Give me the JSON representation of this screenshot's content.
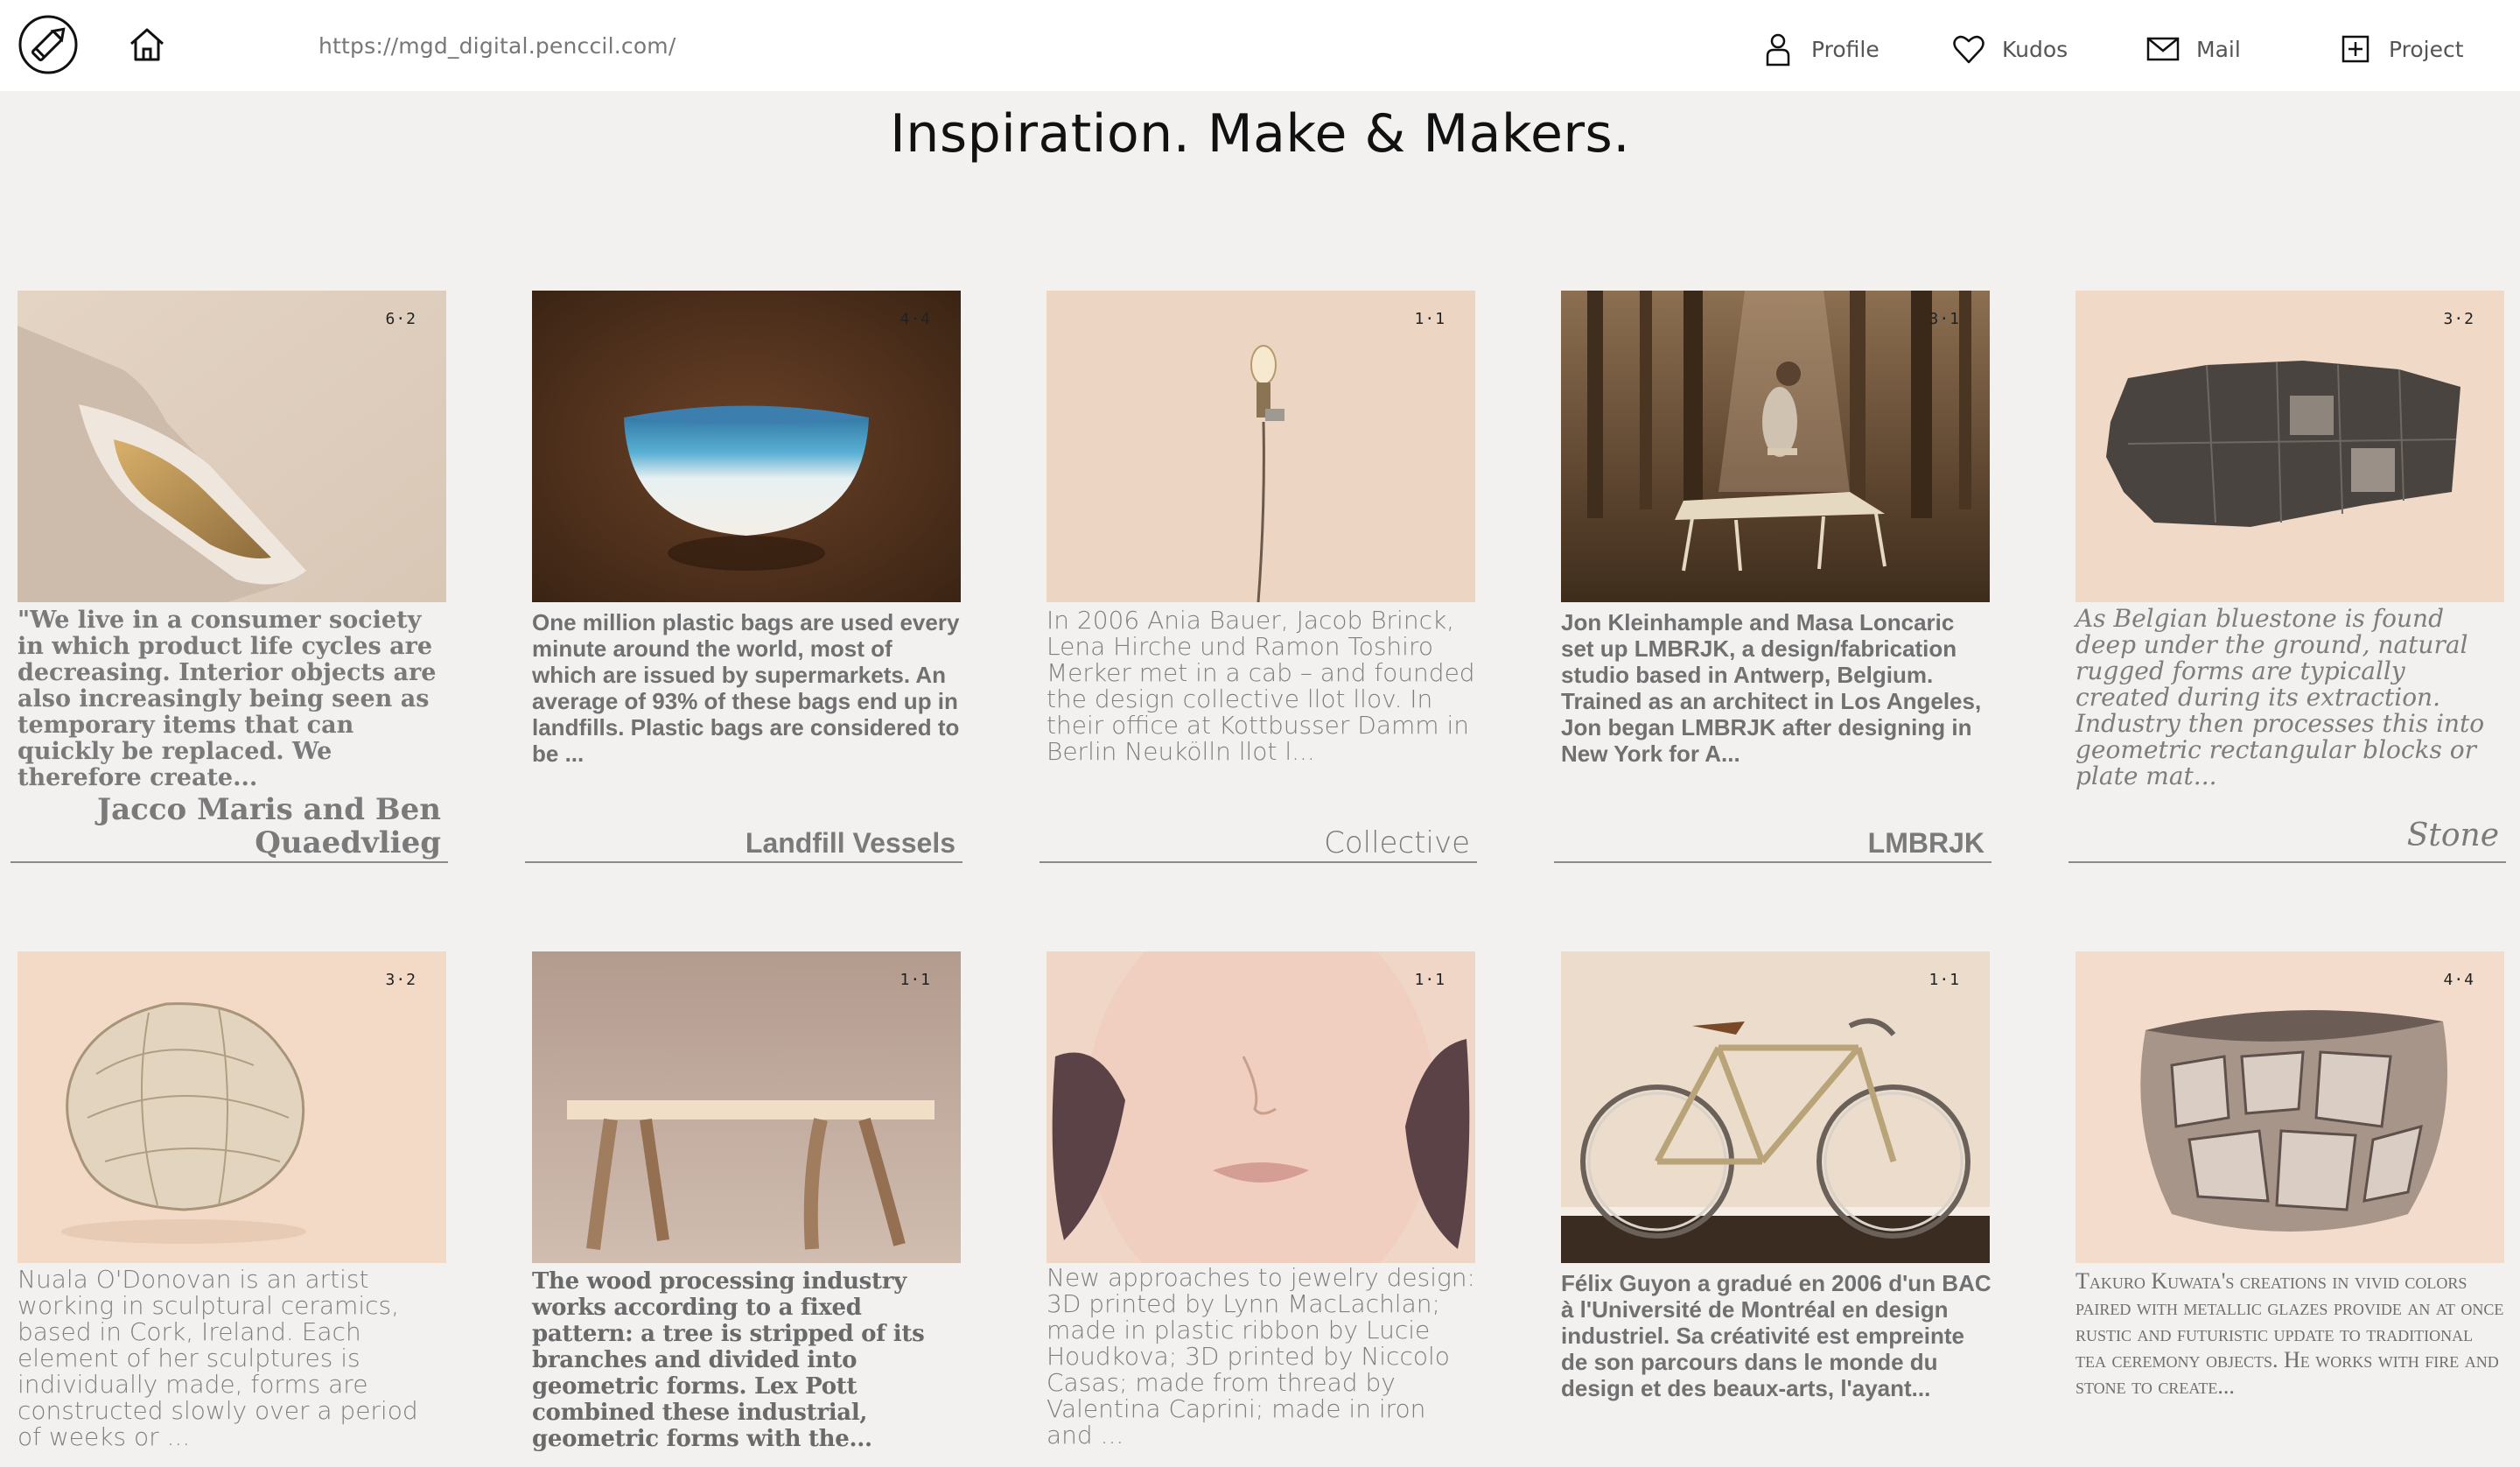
{
  "nav": {
    "url": "https://mgd_digital.penccil.com/",
    "profile": "Profile",
    "kudos": "Kudos",
    "mail": "Mail",
    "project": "Project"
  },
  "page_title": "Inspiration. Make & Makers.",
  "cards": [
    {
      "ratio": "6·2",
      "desc": "\"We live in a consumer society in which product life cycles are decreasing. Interior objects are also increasingly being seen as temporary items that can quickly be replaced. We therefore create...",
      "name": "Jacco Maris and Ben Quaedvlieg"
    },
    {
      "ratio": "4·4",
      "desc": "One million plastic bags are used every minute around the world, most of which are issued by supermarkets. An average of 93% of these bags end up in landfills. Plastic bags are considered to be ...",
      "name": "Landfill Vessels"
    },
    {
      "ratio": "1·1",
      "desc": "In 2006 Ania Bauer, Jacob Brinck, Lena Hirche und Ramon Toshiro Merker met in a cab – and founded the design collective llot llov. In their office at Kottbusser Damm in Berlin Neukölln llot l...",
      "name": "Collective"
    },
    {
      "ratio": "3·1",
      "desc": "Jon Kleinhample and Masa Loncaric set up LMBRJK, a design/fabrication studio based in Antwerp, Belgium. Trained as an architect in Los Angeles, Jon began LMBRJK after designing in New York for A...",
      "name": "LMBRJK"
    },
    {
      "ratio": "3·2",
      "desc": "As Belgian bluestone is found deep under the ground, natural rugged forms are typically created during its extraction. Industry then processes this into geometric rectangular blocks or plate mat...",
      "name": "Stone"
    },
    {
      "ratio": "3·2",
      "desc": "Nuala O'Donovan is an artist working in sculptural ceramics, based in Cork, Ireland. Each element of her sculptures is individually made, forms are constructed slowly over a period of weeks or ..."
    },
    {
      "ratio": "1·1",
      "desc": "The wood processing industry works according to a fixed pattern: a tree is stripped of its branches and divided into geometric forms. Lex Pott combined these industrial, geometric forms with the..."
    },
    {
      "ratio": "1·1",
      "desc": "New approaches to jewelry design: 3D printed by Lynn MacLachlan; made in plastic ribbon by Lucie Houdkova; 3D printed by Niccolo Casas; made from thread by Valentina Caprini; made in iron and ..."
    },
    {
      "ratio": "1·1",
      "desc": "Félix Guyon a gradué en 2006 d'un BAC à l'Université de Montréal en design industriel. Sa créativité est empreinte de son parcours dans le monde du design et des beaux-arts, l'ayant..."
    },
    {
      "ratio": "4·4",
      "desc": "Takuro Kuwata's creations in vivid colors paired with metallic glazes provide an at once rustic and futuristic update to traditional tea ceremony objects. He works with fire and stone to create..."
    }
  ]
}
